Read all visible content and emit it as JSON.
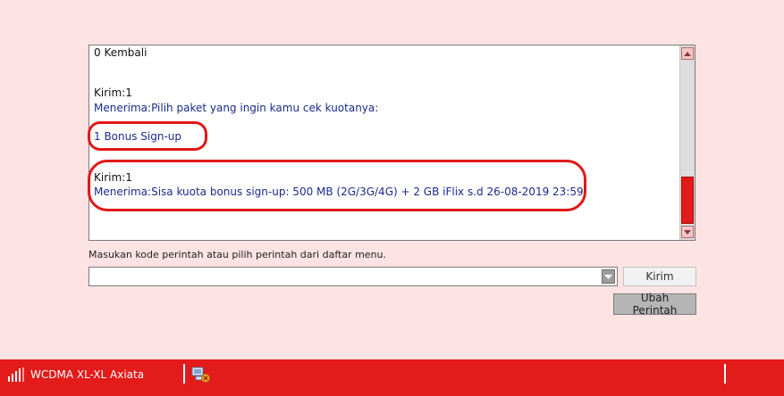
{
  "log": {
    "lines": [
      {
        "text": "0 Kembali",
        "color": "black"
      },
      {
        "text": "Kirim:1",
        "color": "black"
      },
      {
        "text": "Menerima:Pilih paket yang ingin kamu cek kuotanya:",
        "color": "blue"
      },
      {
        "text": "1 Bonus Sign-up",
        "color": "blue"
      },
      {
        "text": "Kirim:1",
        "color": "black"
      },
      {
        "text": "Menerima:Sisa kuota bonus sign-up: 500 MB (2G/3G/4G) + 2 GB iFlix s.d 26-08-2019 23:59",
        "color": "blue"
      }
    ]
  },
  "command": {
    "instruction": "Masukan kode perintah atau pilih perintah dari daftar menu.",
    "value": "",
    "send_label": "Kirim",
    "change_label": "Ubah Perintah"
  },
  "status": {
    "network": "WCDMA  XL-XL Axiata"
  },
  "icons": {
    "signal": "signal-strength-icon",
    "connection": "connection-error-icon",
    "scroll_up": "scroll-up-arrow-icon",
    "scroll_down": "scroll-down-arrow-icon",
    "dropdown": "dropdown-arrow-icon"
  },
  "colors": {
    "background": "#fde3e3",
    "accent": "#e31b1b",
    "sent_text": "#111111",
    "received_text": "#1b2b8c"
  }
}
